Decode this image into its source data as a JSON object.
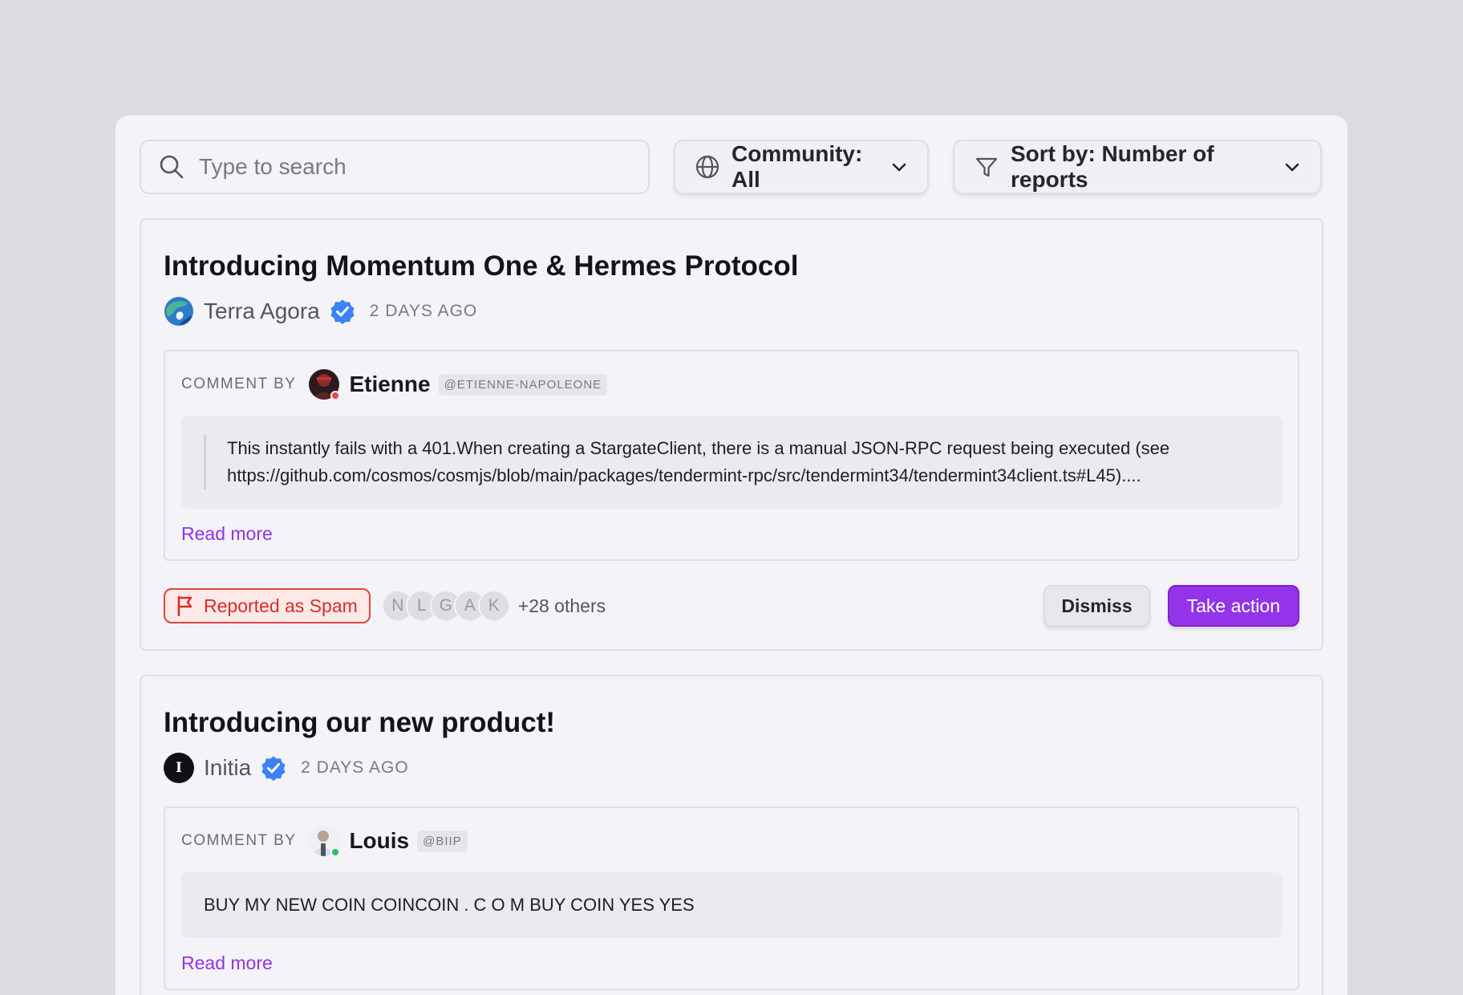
{
  "search": {
    "placeholder": "Type to search"
  },
  "filters": {
    "community_label": "Community: All",
    "sort_label": "Sort by: Number of reports"
  },
  "colors": {
    "accent": "#9333ea",
    "spam": "#d92d27",
    "verified": "#3b82f6"
  },
  "posts": [
    {
      "title": "Introducing Momentum One & Hermes Protocol",
      "community": "Terra Agora",
      "time": "2 DAYS AGO",
      "comment_by_label": "COMMENT BY",
      "commenter": "Etienne",
      "handle": "@ETIENNE-NAPOLEONE",
      "comment_text": "This instantly fails with a 401.When creating a StargateClient, there is a manual JSON-RPC request being executed (see https://github.com/cosmos/cosmjs/blob/main/packages/tendermint-rpc/src/tendermint34/tendermint34client.ts#L45)....",
      "read_more": "Read more",
      "report_label": "Reported as Spam",
      "reporters": [
        "N",
        "L",
        "G",
        "A",
        "K"
      ],
      "others": "+28 others",
      "dismiss_label": "Dismiss",
      "take_action_label": "Take action"
    },
    {
      "title": "Introducing our new product!",
      "community": "Initia",
      "community_initial": "I",
      "time": "2 DAYS AGO",
      "comment_by_label": "COMMENT BY",
      "commenter": "Louis",
      "handle": "@BIIP",
      "comment_text": "BUY MY NEW COIN COINCOIN . C O M BUY COIN YES YES",
      "read_more": "Read more"
    }
  ]
}
